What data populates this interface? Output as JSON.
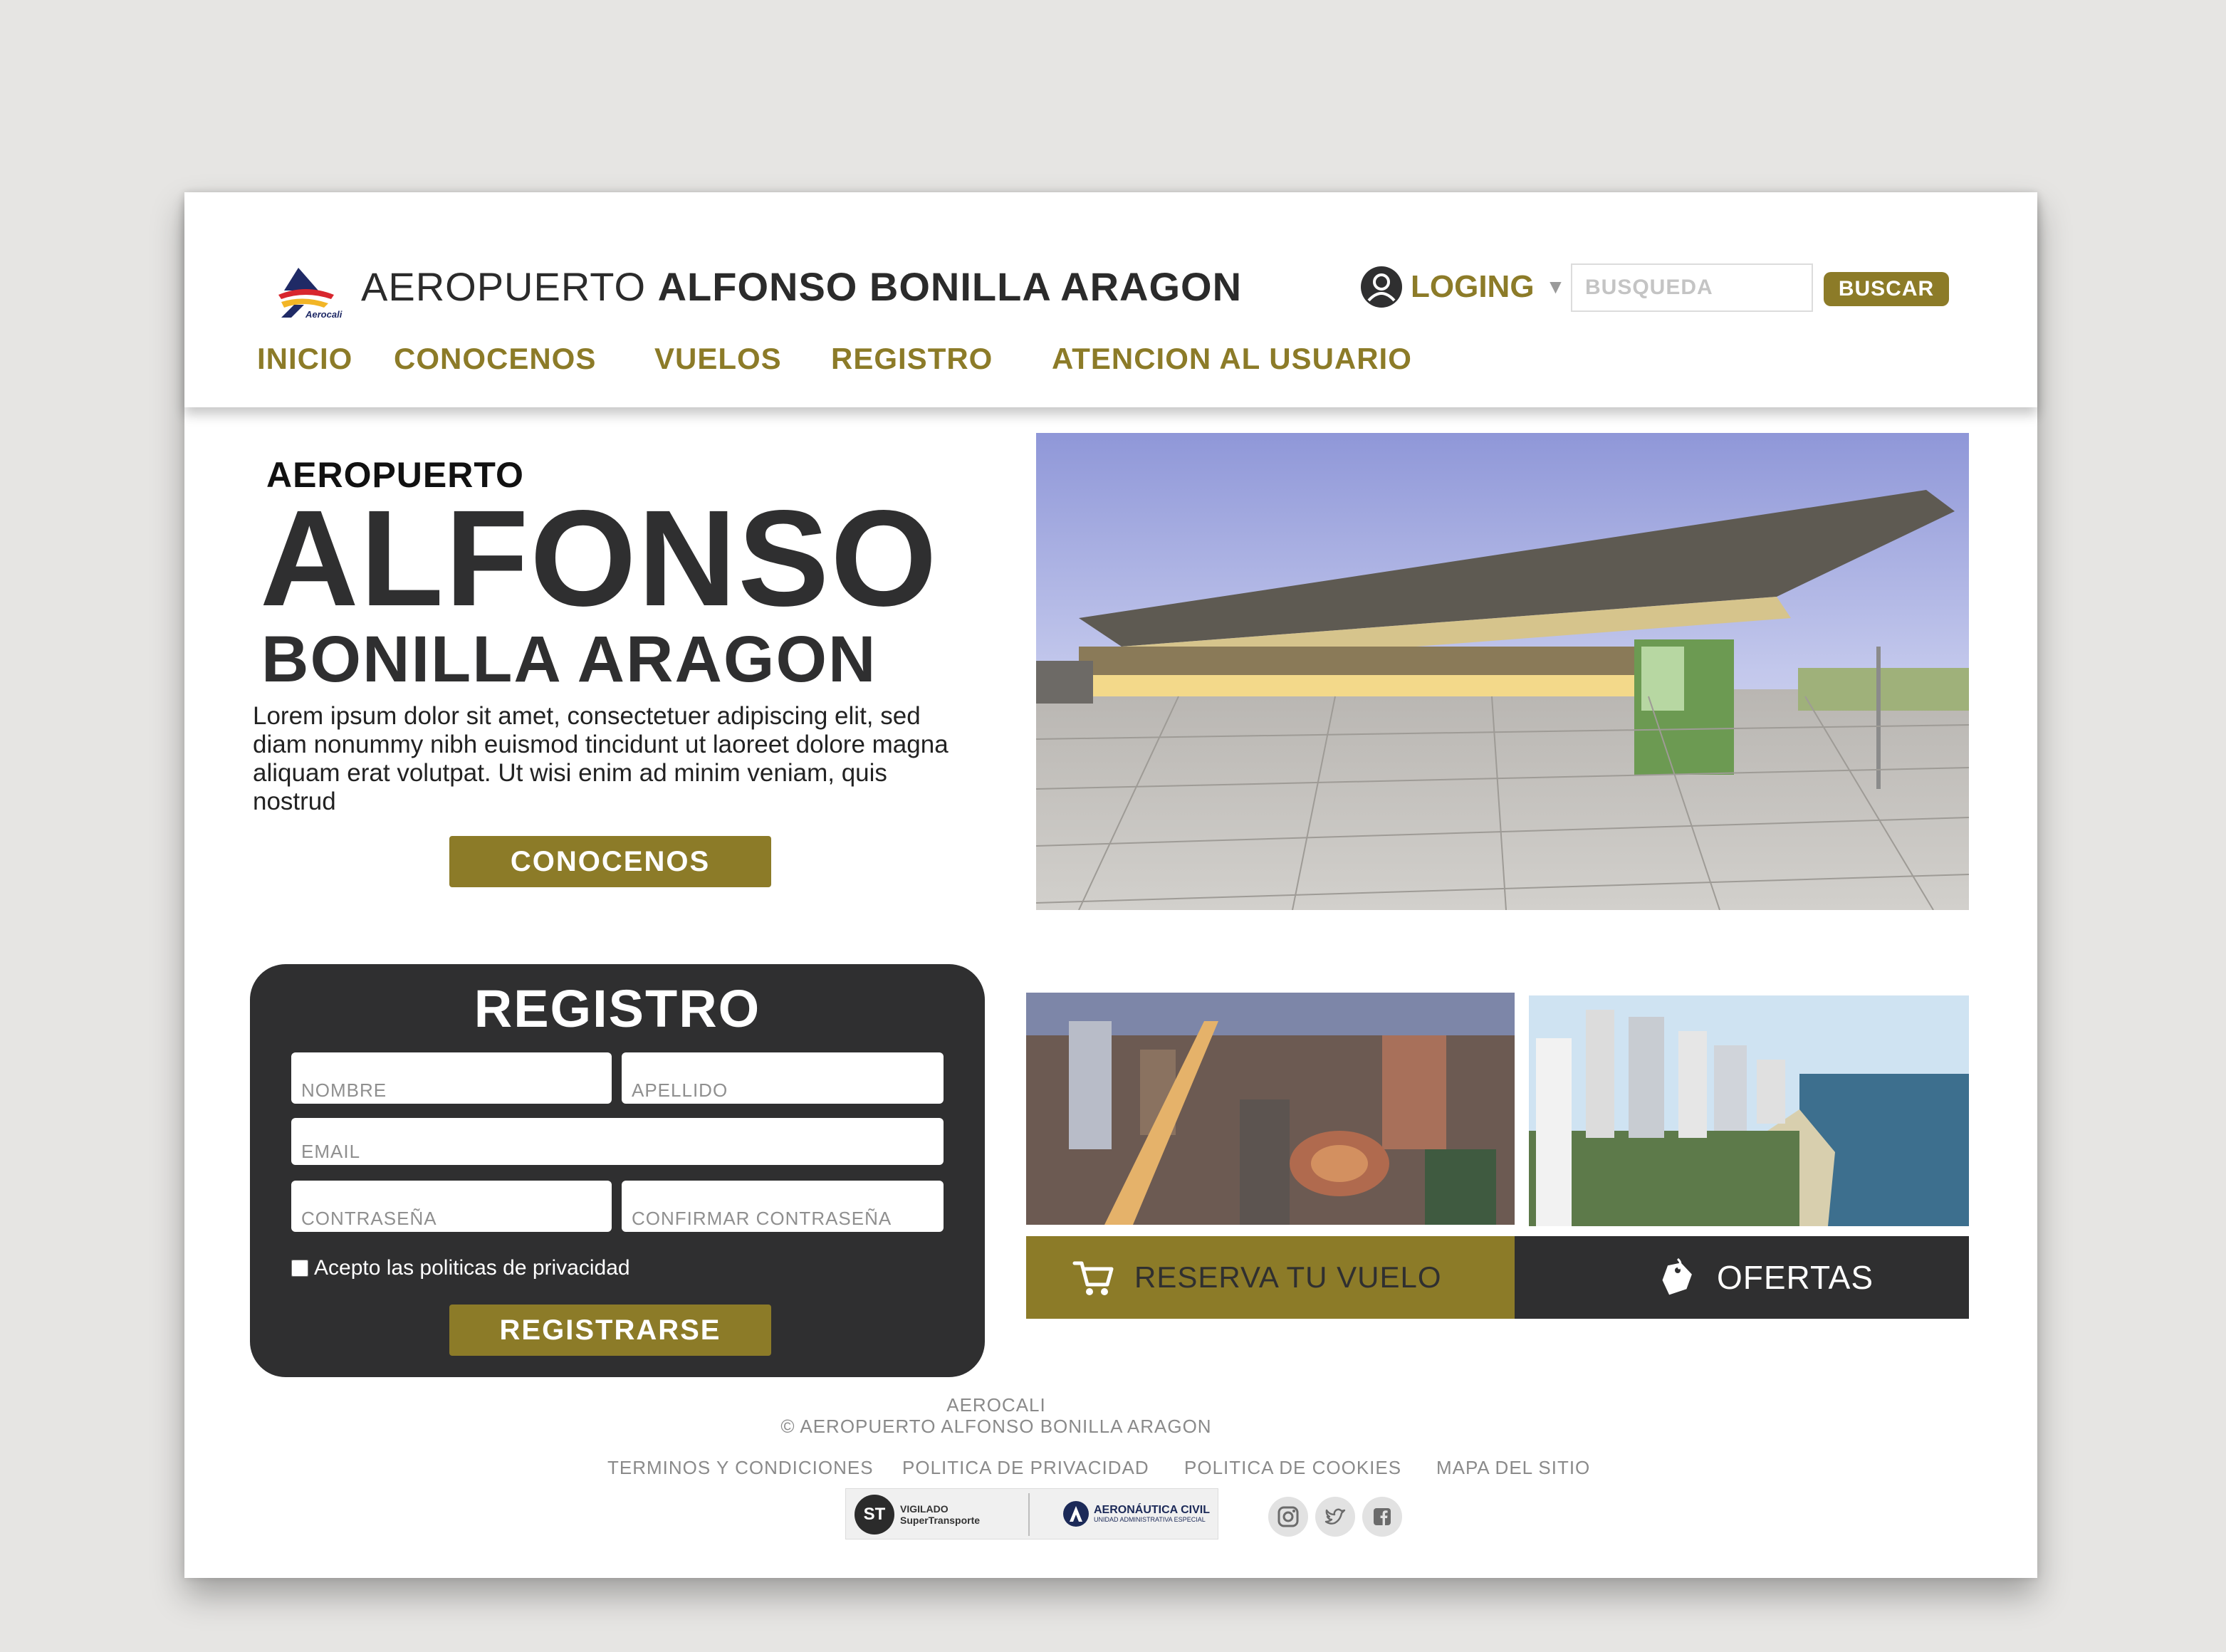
{
  "brand": {
    "logo_text": "Aerocali",
    "title_light": "AEROPUERTO",
    "title_bold": "ALFONSO BONILLA ARAGON"
  },
  "header": {
    "login_label": "LOGING",
    "search_placeholder": "BUSQUEDA",
    "search_button": "BUSCAR"
  },
  "nav": {
    "items": [
      "INICIO",
      "CONOCENOS",
      "VUELOS",
      "REGISTRO",
      "ATENCION AL USUARIO"
    ]
  },
  "hero": {
    "kicker": "AEROPUERTO",
    "title": "ALFONSO",
    "subtitle": "BONILLA ARAGON",
    "body": "Lorem ipsum dolor sit amet, consectetuer adipiscing elit, sed diam nonummy nibh euismod tincidunt ut laoreet dolore magna aliquam erat volutpat. Ut wisi enim ad minim veniam, quis nostrud",
    "button": "CONOCENOS"
  },
  "register": {
    "title": "REGISTRO",
    "fields": {
      "nombre": "NOMBRE",
      "apellido": "APELLIDO",
      "email": "EMAIL",
      "password": "CONTRASEÑA",
      "confirm": "CONFIRMAR CONTRASEÑA"
    },
    "privacy_label": "Acepto las politicas de privacidad",
    "button": "REGISTRARSE"
  },
  "actions": {
    "reserve": "RESERVA TU VUELO",
    "offers": "OFERTAS"
  },
  "footer": {
    "brand": "AEROCALI",
    "copyright": "© AEROPUERTO ALFONSO BONILLA ARAGON",
    "links": [
      "TERMINOS Y CONDICIONES",
      "POLITICA DE PRIVACIDAD",
      "POLITICA DE COOKIES",
      "MAPA DEL SITIO"
    ],
    "badge_st": {
      "mark": "ST",
      "line1": "VIGILADO",
      "line2": "SuperTransporte"
    },
    "badge_aero": {
      "line1": "AERONÁUTICA CIVIL",
      "line2": "UNIDAD ADMINISTRATIVA ESPECIAL"
    }
  },
  "icons": {
    "user": "user-icon",
    "caret": "chevron-down-icon",
    "cart": "cart-icon",
    "tag": "tag-icon",
    "instagram": "instagram-icon",
    "twitter": "twitter-icon",
    "facebook": "facebook-icon"
  },
  "colors": {
    "accent": "#8c7b28",
    "dark": "#2f2f30",
    "background": "#e6e5e3",
    "footer_text": "#8a8a8a"
  }
}
